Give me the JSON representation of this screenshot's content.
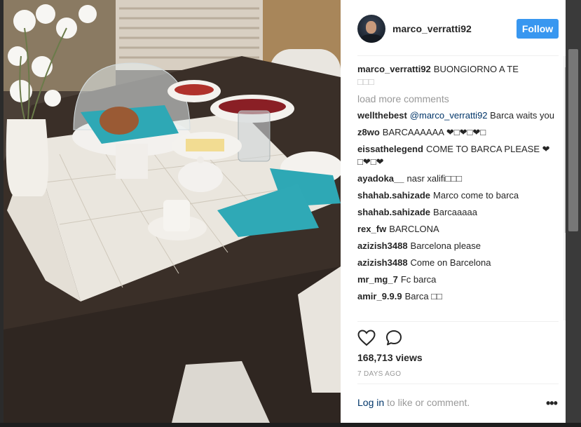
{
  "post": {
    "username": "marco_verratti92",
    "follow_label": "Follow",
    "caption_user": "marco_verratti92",
    "caption_text": "BUONGIORNO A TE",
    "caption_emoji": "□□□",
    "load_more_label": "load more comments",
    "comments": [
      {
        "user": "wellthebest",
        "mention": "@marco_verratti92",
        "text": "Barca waits you"
      },
      {
        "user": "z8wo",
        "mention": "",
        "text": "BARCAAAAAA ❤□❤□❤□"
      },
      {
        "user": "eissathelegend",
        "mention": "",
        "text": "COME TO BARCA PLEASE ❤□❤□❤"
      },
      {
        "user": "ayadoka__",
        "mention": "",
        "text": "nasr xalifi□□□"
      },
      {
        "user": "shahab.sahizade",
        "mention": "",
        "text": "Marco come to barca"
      },
      {
        "user": "shahab.sahizade",
        "mention": "",
        "text": "Barcaaaaa"
      },
      {
        "user": "rex_fw",
        "mention": "",
        "text": "BARCLONA"
      },
      {
        "user": "azizish3488",
        "mention": "",
        "text": "Barcelona please"
      },
      {
        "user": "azizish3488",
        "mention": "",
        "text": "Come on Barcelona"
      },
      {
        "user": "mr_mg_7",
        "mention": "",
        "text": "Fc barca"
      },
      {
        "user": "amir_9.9.9",
        "mention": "",
        "text": "Barca □□"
      }
    ],
    "views": "168,713 views",
    "timestamp": "7 DAYS AGO",
    "login_link": "Log in",
    "login_suffix": "to like or comment.",
    "more_label": "•••"
  },
  "icons": {
    "like": "heart-icon",
    "comment": "comment-bubble-icon",
    "more": "more-options-icon"
  },
  "colors": {
    "follow_button": "#3897f0",
    "link": "#003569",
    "muted": "#999999",
    "text": "#262626"
  }
}
